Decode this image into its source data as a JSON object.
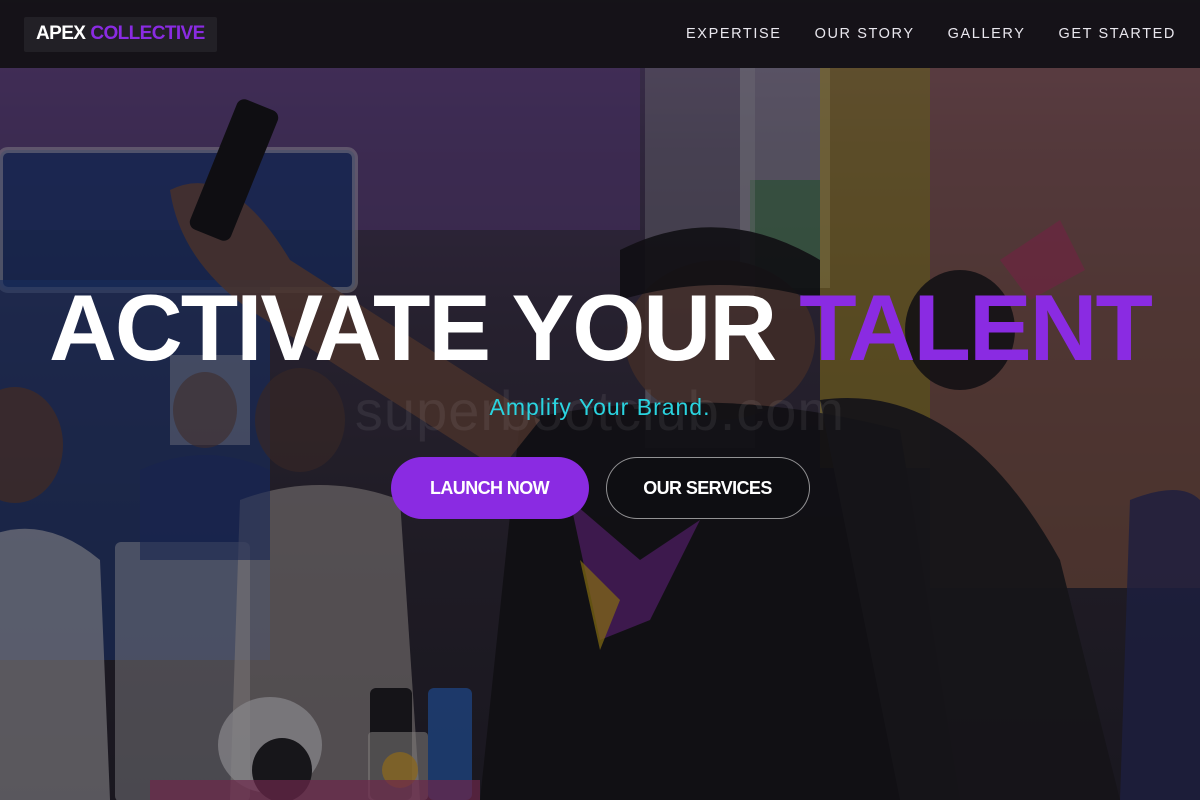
{
  "brand": {
    "name_part1": "APEX",
    "name_part2": "COLLECTIVE",
    "accent_color": "#8a2be2"
  },
  "nav": {
    "links": [
      "EXPERTISE",
      "OUR STORY",
      "GALLERY",
      "GET STARTED"
    ]
  },
  "hero": {
    "headline_main": "ACTIVATE YOUR ",
    "headline_accent": "TALENT",
    "subheadline": "Amplify Your Brand.",
    "subheadline_color": "#2ad4e0",
    "watermark": "superbootclub.com",
    "primary_button": "LAUNCH NOW",
    "secondary_button": "OUR SERVICES"
  }
}
